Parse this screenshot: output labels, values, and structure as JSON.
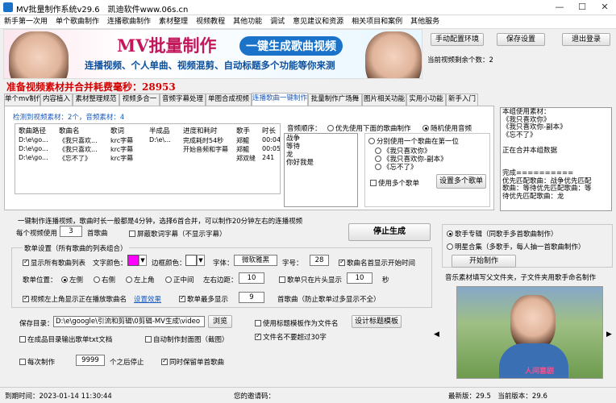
{
  "window": {
    "title": "MV批量制作系统v29.6　凯迪软件www.06s.cn"
  },
  "menu": [
    "新手第一次用",
    "单个歌曲制作",
    "连播歌曲制作",
    "素材整理",
    "视频教程",
    "其他功能",
    "调试",
    "意见建议和资源",
    "相关项目和案例",
    "其他服务"
  ],
  "banner": {
    "title": "MV批量制作",
    "badge": "一键生成歌曲视频",
    "subtitle": "连播视频、个人单曲、视频混剪、自动标题多个功能等你来测"
  },
  "top_buttons": {
    "manual_config": "手动配置环境",
    "save_settings": "保存设置",
    "logout": "退出登录"
  },
  "remaining": "当前视频剩余个数：2",
  "promo_line": "准备视频素材并合并耗费毫秒：28953",
  "tabs": [
    "单个mv制作",
    "内容植入",
    "素材整理规范",
    "视频多合一",
    "音频字幕处理",
    "单图合成视频",
    "连播歌曲一键制作",
    "批量制作广场舞",
    "图片相关功能",
    "实用小功能",
    "新手入门"
  ],
  "active_tab": "连播歌曲一键制作",
  "detect": "检测到视频素材：2个，音频素材：4",
  "table": {
    "headers": [
      "歌曲路径",
      "歌曲名",
      "歌词",
      "半成品",
      "进度和耗时",
      "歌手",
      "时长"
    ],
    "rows": [
      [
        "D:\\e\\go...",
        "《我只喜欢...",
        "krc字幕",
        "D:\\e\\...",
        "完成耗时54秒",
        "郑鲲",
        "00:04"
      ],
      [
        "D:\\e\\go...",
        "《我只喜欢...",
        "krc字幕",
        "",
        "开始音频和字幕",
        "郑鲲",
        "00:05"
      ],
      [
        "D:\\e\\go...",
        "《忘不了》",
        "krc字幕",
        "",
        "",
        "郑双缝",
        "241"
      ]
    ]
  },
  "order": {
    "label": "音频顺序：",
    "opt1": "优先使用下面的歌曲制作",
    "opt2": "随机使用音频"
  },
  "song_list": [
    "战争",
    "等待",
    "龙",
    "你好我是"
  ],
  "song_opts": {
    "cat_label": "分别使用一个歌曲在第一位",
    "items": [
      "《我只喜欢你》",
      "《我只喜欢你-副本》",
      "《忘不了》"
    ],
    "use_multi": "使用多个歌单",
    "setup_btn": "设置多个歌单"
  },
  "info_box": [
    "本组使用素材：",
    "《我只喜欢你》",
    "《我只喜欢你-副本》",
    "《忘不了》",
    "",
    "正在合并本组数据",
    "",
    "",
    "完成==========",
    "优先匹配歌曲：战争优先匹配",
    "歌曲：等待优先匹配歌曲：等",
    "待优先匹配歌曲：龙"
  ],
  "note": "一键制作连播视频，歌曲时长一般都是4分钟，选择6首合并，可以制作20分钟左右的连播视频",
  "per_video": {
    "label": "每个视频使用",
    "value": "3",
    "unit": "首歌曲"
  },
  "block_lyrics": "屏蔽歌词字幕（不显示字幕）",
  "stop_btn": "停止生成",
  "song_list_group": "歌单设置（所有歌曲的列表组合）",
  "show_all": "显示所有歌曲列表",
  "text_color_label": "文字颜色：",
  "text_color": "#ff00ff",
  "border_color_label": "边框颜色：",
  "font_label": "字体：",
  "font_value": "微软雅黑",
  "size_label": "字号：",
  "size_value": "28",
  "show_at_start": "歌曲名首显示开始时间",
  "pos_label": "歌单位置：",
  "pos_opts": [
    "左侧",
    "右侧",
    "左上角",
    "正中间"
  ],
  "margin_label": "左右边距：",
  "margin_value": "10",
  "show_head": "歌单只在片头显示",
  "head_value": "10",
  "head_unit": "秒",
  "show_top_left": "视频左上角显示正在播放歌曲名",
  "set_effect": "设置效果",
  "max_display": "歌单最多显示",
  "max_value": "9",
  "max_unit": "首歌曲（防止歌单过多显示不全）",
  "save_dir_label": "保存目录：",
  "save_dir": "D:\\e\\google\\引流和剪辑\\0剪辑-MV生成\\video",
  "browse": "浏览",
  "use_title_tpl": "使用标题模板作为文件名",
  "design_tpl": "设计标题模板",
  "out_txt": "在成品目录输出歌单txt文档",
  "auto_cover": "自动制作封面图（截图）",
  "name_limit": "文件名不要超过30字",
  "each_make": "每次制作",
  "each_value": "9999",
  "each_unit": "个之后停止",
  "keep_single": "同时保留单首歌曲",
  "singer_mode": "歌手专辑（同歌手多首歌曲制作）",
  "album_mode": "明星合集（多歌手，每人抽一首歌曲制作）",
  "start_btn": "开始制作",
  "folder_note": "音乐素材填写父文件夹，子文件夹用歌手命名制作",
  "promo_caption": "人间喜剧",
  "status": {
    "expire": "到期时间：2023-01-14 11:30:44",
    "invite": "您的邀请码：",
    "version": "最新版：29.5　当前版本：29.6"
  }
}
